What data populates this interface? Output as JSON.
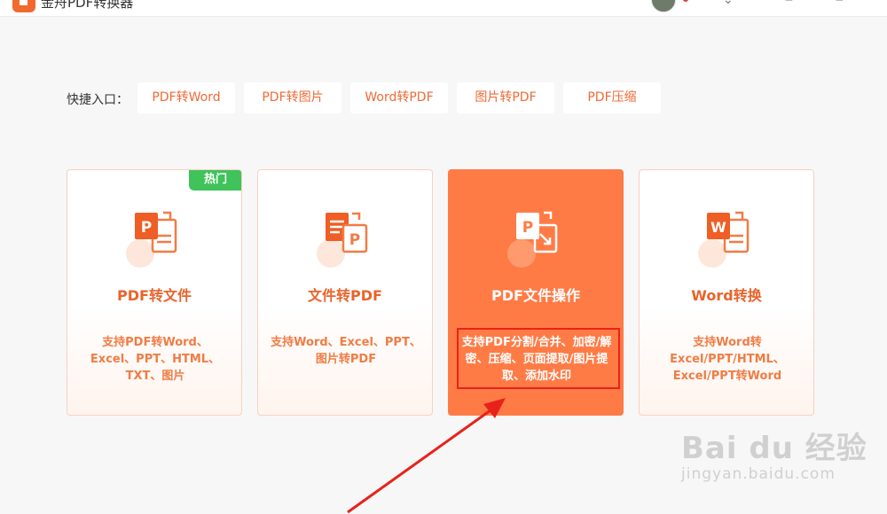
{
  "app": {
    "title": "金舟PDF转换器"
  },
  "quick_entry": {
    "label": "快捷入口：",
    "items": [
      "PDF转Word",
      "PDF转图片",
      "Word转PDF",
      "图片转PDF",
      "PDF压缩"
    ]
  },
  "cards": [
    {
      "title": "PDF转文件",
      "desc": "支持PDF转Word、Excel、PPT、HTML、TXT、图片",
      "badge": "热门",
      "icon": "pdf-to-file-icon"
    },
    {
      "title": "文件转PDF",
      "desc": "支持Word、Excel、PPT、图片转PDF",
      "icon": "file-to-pdf-icon"
    },
    {
      "title": "PDF文件操作",
      "desc": "支持PDF分割/合并、加密/解密、压缩、页面提取/图片提取、添加水印",
      "icon": "pdf-operation-icon",
      "active": true
    },
    {
      "title": "Word转换",
      "desc": "支持Word转Excel/PPT/HTML、Excel/PPT转Word",
      "icon": "word-convert-icon"
    }
  ],
  "watermark": {
    "main": "Bai du 经验",
    "sub": "jingyan.baidu.com"
  },
  "colors": {
    "accent": "#ef6a36",
    "active_card": "#ff7b46",
    "hot_badge": "#3fc35a",
    "highlight": "#e8221b"
  }
}
